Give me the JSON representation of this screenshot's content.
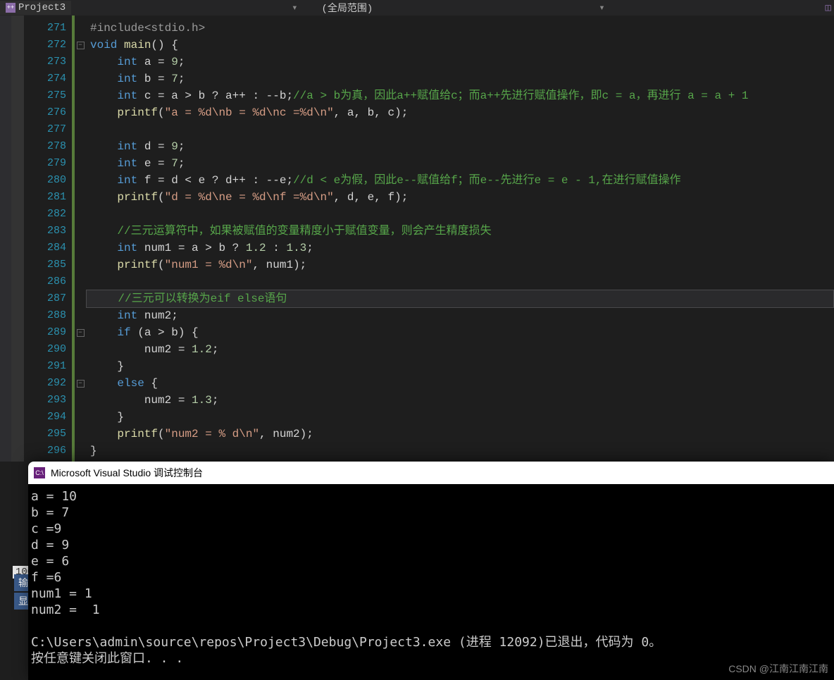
{
  "tab": {
    "name": "Project3"
  },
  "scope": "(全局范围)",
  "line_start": 271,
  "line_end": 296,
  "code_lines": [
    {
      "n": 271,
      "html": "<span class='inc'>#include</span><span class='inc'>&lt;stdio.h&gt;</span>"
    },
    {
      "n": 272,
      "fold": "-",
      "html": "<span class='kw'>void</span> <span class='fn'>main</span>() {"
    },
    {
      "n": 273,
      "html": "    <span class='kw'>int</span> a = <span class='num'>9</span>;"
    },
    {
      "n": 274,
      "html": "    <span class='kw'>int</span> b = <span class='num'>7</span>;"
    },
    {
      "n": 275,
      "html": "    <span class='kw'>int</span> c = a &gt; b ? a++ : --b;<span class='cm'>//a &gt; b为真，因此a++赋值给c；而a++先进行赋值操作，即c = a，再进行 a = a + 1</span>"
    },
    {
      "n": 276,
      "html": "    <span class='fn'>printf</span>(<span class='str'>\"a = %d\\nb = %d\\nc =%d\\n\"</span>, a, b, c);"
    },
    {
      "n": 277,
      "html": ""
    },
    {
      "n": 278,
      "html": "    <span class='kw'>int</span> d = <span class='num'>9</span>;"
    },
    {
      "n": 279,
      "html": "    <span class='kw'>int</span> e = <span class='num'>7</span>;"
    },
    {
      "n": 280,
      "html": "    <span class='kw'>int</span> f = d &lt; e ? d++ : --e;<span class='cm'>//d &lt; e为假，因此e--赋值给f；而e--先进行e = e - 1,在进行赋值操作</span>"
    },
    {
      "n": 281,
      "html": "    <span class='fn'>printf</span>(<span class='str'>\"d = %d\\ne = %d\\nf =%d\\n\"</span>, d, e, f);"
    },
    {
      "n": 282,
      "html": ""
    },
    {
      "n": 283,
      "html": "    <span class='cm'>//三元运算符中，如果被赋值的变量精度小于赋值变量，则会产生精度损失</span>"
    },
    {
      "n": 284,
      "html": "    <span class='kw'>int</span> num1 = a &gt; b ? <span class='num'>1.2</span> : <span class='num'>1.3</span>;"
    },
    {
      "n": 285,
      "html": "    <span class='fn'>printf</span>(<span class='str'>\"num1 = %d\\n\"</span>, num1);"
    },
    {
      "n": 286,
      "html": ""
    },
    {
      "n": 287,
      "hl": true,
      "html": "    <span class='cm'>//三元可以转换为eif else语句</span>"
    },
    {
      "n": 288,
      "html": "    <span class='kw'>int</span> num2;"
    },
    {
      "n": 289,
      "fold": "-",
      "html": "    <span class='kw'>if</span> (a &gt; b) {"
    },
    {
      "n": 290,
      "html": "        num2 = <span class='num'>1.2</span>;"
    },
    {
      "n": 291,
      "html": "    }"
    },
    {
      "n": 292,
      "fold": "-",
      "html": "    <span class='kw'>else</span> {"
    },
    {
      "n": 293,
      "html": "        num2 = <span class='num'>1.3</span>;"
    },
    {
      "n": 294,
      "html": "    }"
    },
    {
      "n": 295,
      "html": "    <span class='fn'>printf</span>(<span class='str'>\"num2 = % d\\n\"</span>, num2);"
    },
    {
      "n": 296,
      "html": "}"
    }
  ],
  "zoom": "100",
  "side_tags": [
    "输",
    "显"
  ],
  "console": {
    "title": "Microsoft Visual Studio 调试控制台",
    "output": "a = 10\nb = 7\nc =9\nd = 9\ne = 6\nf =6\nnum1 = 1\nnum2 =  1\n\nC:\\Users\\admin\\source\\repos\\Project3\\Debug\\Project3.exe (进程 12092)已退出，代码为 0。\n按任意键关闭此窗口. . ."
  },
  "watermark": "CSDN @江南江南江南"
}
